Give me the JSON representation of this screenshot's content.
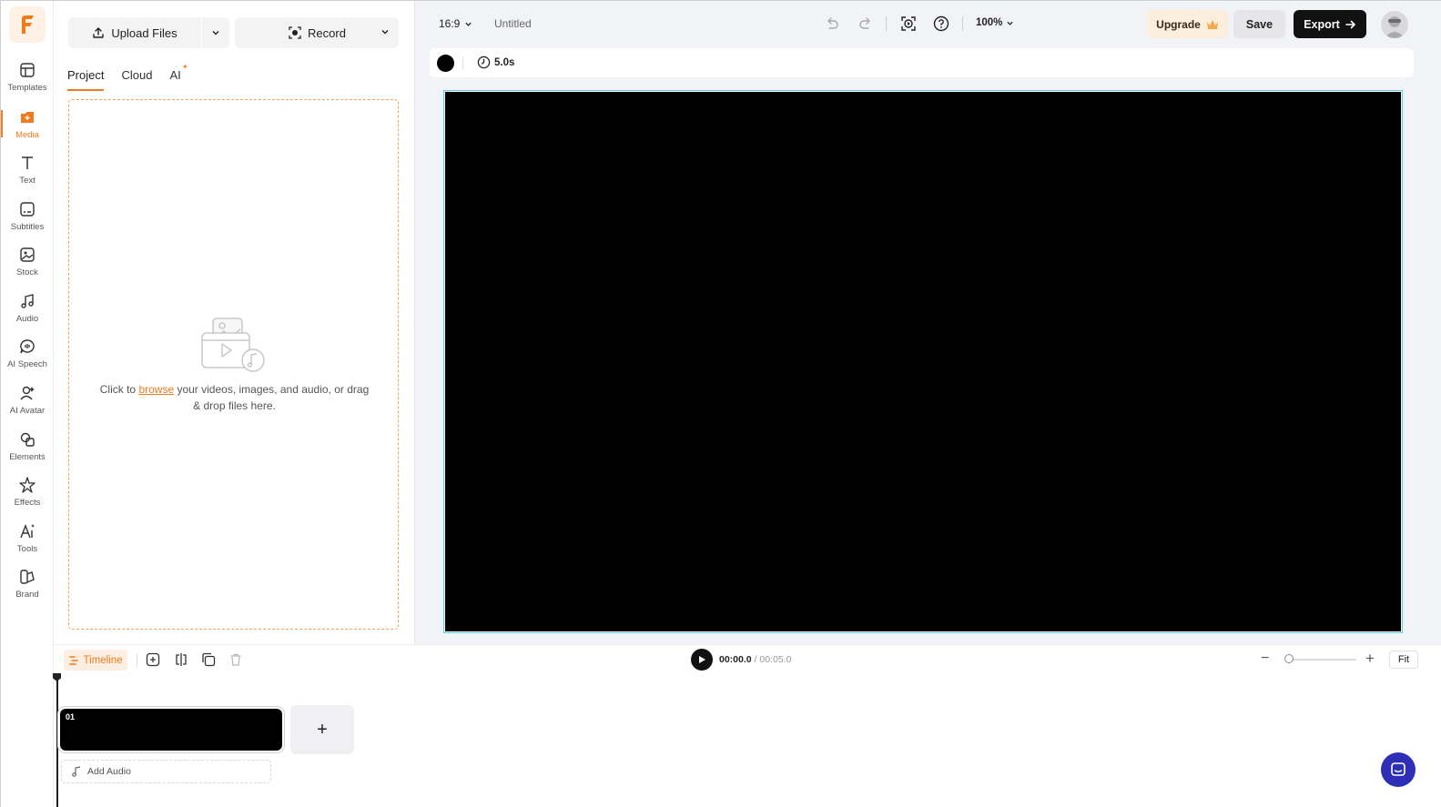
{
  "brand": {
    "logo_letter": "F",
    "accent": "#f27a1a"
  },
  "rail": [
    {
      "label": "Templates",
      "icon": "templates-icon"
    },
    {
      "label": "Media",
      "icon": "media-icon",
      "active": true
    },
    {
      "label": "Text",
      "icon": "text-icon"
    },
    {
      "label": "Subtitles",
      "icon": "subtitles-icon"
    },
    {
      "label": "Stock",
      "icon": "stock-icon"
    },
    {
      "label": "Audio",
      "icon": "audio-icon"
    },
    {
      "label": "AI Speech",
      "icon": "ai-speech-icon"
    },
    {
      "label": "AI Avatar",
      "icon": "ai-avatar-icon"
    },
    {
      "label": "Elements",
      "icon": "elements-icon"
    },
    {
      "label": "Effects",
      "icon": "effects-icon"
    },
    {
      "label": "Tools",
      "icon": "tools-icon"
    },
    {
      "label": "Brand",
      "icon": "brand-icon"
    }
  ],
  "panel": {
    "upload_label": "Upload Files",
    "record_label": "Record",
    "tabs": [
      "Project",
      "Cloud",
      "AI"
    ],
    "drop_prefix": "Click to ",
    "drop_link": "browse",
    "drop_suffix": " your videos, images, and audio, or drag & drop files here."
  },
  "topbar": {
    "ratio": "16:9",
    "title": "Untitled",
    "zoom": "100%",
    "upgrade": "Upgrade",
    "save": "Save",
    "export": "Export"
  },
  "props": {
    "duration": "5.0s",
    "background_color": "#000000"
  },
  "timeline": {
    "label": "Timeline",
    "current": "00:00.0",
    "separator": " / ",
    "total": "00:05.0",
    "fit": "Fit",
    "clip_number": "01",
    "add_audio": "Add Audio"
  }
}
